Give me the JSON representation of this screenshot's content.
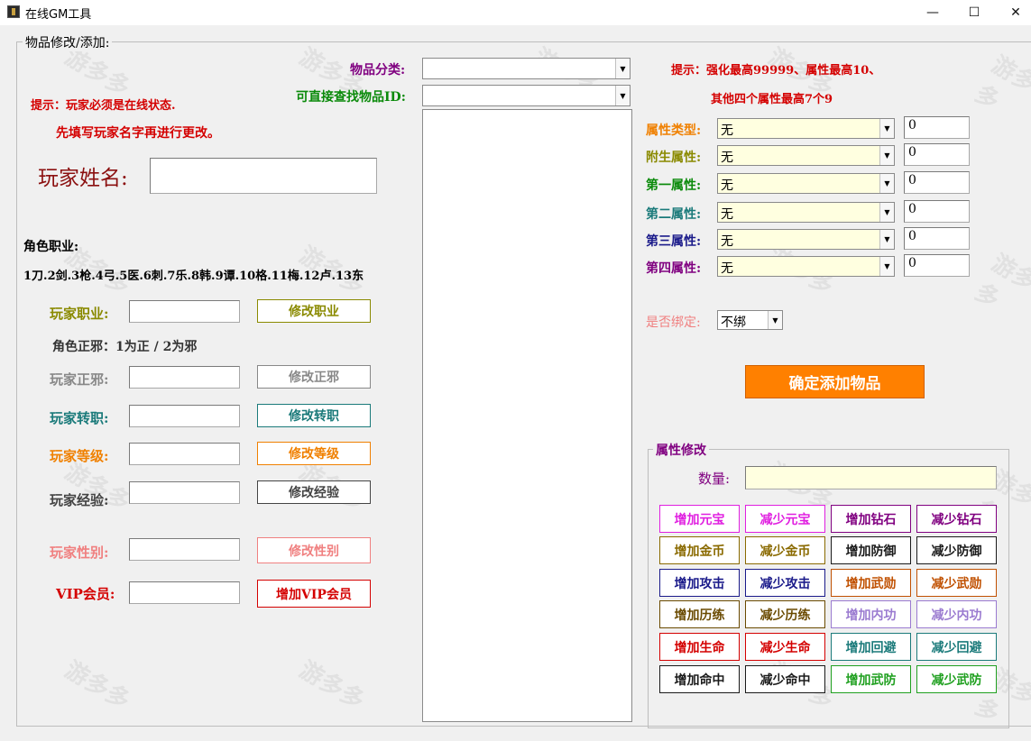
{
  "window": {
    "title": "在线GM工具",
    "minimize": "—",
    "maximize": "☐",
    "close": "✕"
  },
  "watermark": "游多多",
  "left": {
    "group_title": "物品修改/添加:",
    "tip1": "提示：玩家必须是在线状态.",
    "tip2": "先填写玩家名字再进行更改。",
    "player_name_label": "玩家姓名:",
    "player_name_value": "",
    "job_header": "角色职业:",
    "job_list": "1刀.2剑.3枪.4弓.5医.6刺.7乐.8韩.9谭.10格.11梅.12卢.13东",
    "job_label": "玩家职业:",
    "job_btn": "修改职业",
    "zx_header": "角色正邪：1为正 / 2为邪",
    "zx_label": "玩家正邪:",
    "zx_btn": "修改正邪",
    "zz_label": "玩家转职:",
    "zz_btn": "修改转职",
    "level_label": "玩家等级:",
    "level_btn": "修改等级",
    "exp_label": "玩家经验:",
    "exp_btn": "修改经验",
    "gender_label": "玩家性别:",
    "gender_btn": "修改性别",
    "vip_label": "VIP会员:",
    "vip_btn": "增加VIP会员"
  },
  "middle": {
    "category_label": "物品分类:",
    "category_value": "",
    "find_label": "可直接查找物品ID:",
    "find_value": ""
  },
  "right": {
    "tip1": "提示：强化最高99999、属性最高10、",
    "tip2": "其他四个属性最高7个9",
    "attrs": [
      {
        "label": "属性类型:",
        "value": "无",
        "num": "0"
      },
      {
        "label": "附生属性:",
        "value": "无",
        "num": "0"
      },
      {
        "label": "第一属性:",
        "value": "无",
        "num": "0"
      },
      {
        "label": "第二属性:",
        "value": "无",
        "num": "0"
      },
      {
        "label": "第三属性:",
        "value": "无",
        "num": "0"
      },
      {
        "label": "第四属性:",
        "value": "无",
        "num": "0"
      }
    ],
    "bind_label": "是否绑定:",
    "bind_value": "不绑",
    "add_btn": "确定添加物品",
    "attr_group_title": "属性修改",
    "qty_label": "数量:",
    "qty_value": "",
    "buttons": [
      "增加元宝",
      "减少元宝",
      "增加钻石",
      "减少钻石",
      "增加金币",
      "减少金币",
      "增加防御",
      "减少防御",
      "增加攻击",
      "减少攻击",
      "增加武勋",
      "减少武勋",
      "增加历练",
      "减少历练",
      "增加内功",
      "减少内功",
      "增加生命",
      "减少生命",
      "增加回避",
      "减少回避",
      "增加命中",
      "减少命中",
      "增加武防",
      "减少武防"
    ]
  }
}
